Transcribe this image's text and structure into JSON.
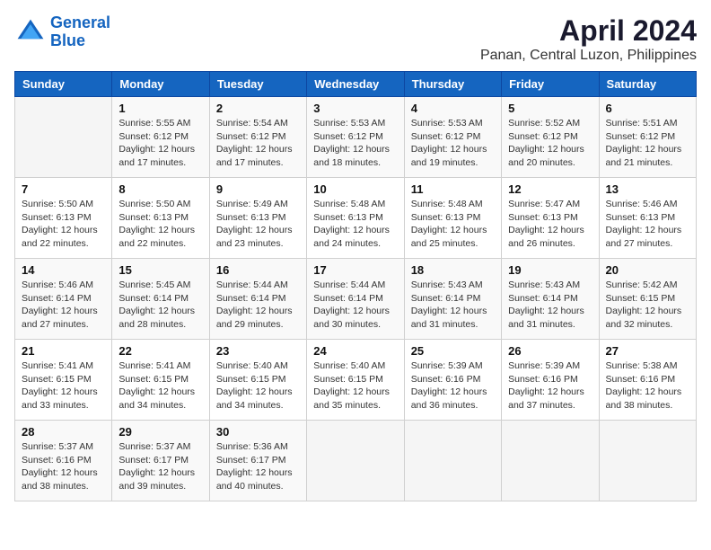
{
  "logo": {
    "line1": "General",
    "line2": "Blue"
  },
  "title": "April 2024",
  "subtitle": "Panan, Central Luzon, Philippines",
  "weekdays": [
    "Sunday",
    "Monday",
    "Tuesday",
    "Wednesday",
    "Thursday",
    "Friday",
    "Saturday"
  ],
  "weeks": [
    [
      {
        "day": "",
        "detail": ""
      },
      {
        "day": "1",
        "detail": "Sunrise: 5:55 AM\nSunset: 6:12 PM\nDaylight: 12 hours\nand 17 minutes."
      },
      {
        "day": "2",
        "detail": "Sunrise: 5:54 AM\nSunset: 6:12 PM\nDaylight: 12 hours\nand 17 minutes."
      },
      {
        "day": "3",
        "detail": "Sunrise: 5:53 AM\nSunset: 6:12 PM\nDaylight: 12 hours\nand 18 minutes."
      },
      {
        "day": "4",
        "detail": "Sunrise: 5:53 AM\nSunset: 6:12 PM\nDaylight: 12 hours\nand 19 minutes."
      },
      {
        "day": "5",
        "detail": "Sunrise: 5:52 AM\nSunset: 6:12 PM\nDaylight: 12 hours\nand 20 minutes."
      },
      {
        "day": "6",
        "detail": "Sunrise: 5:51 AM\nSunset: 6:12 PM\nDaylight: 12 hours\nand 21 minutes."
      }
    ],
    [
      {
        "day": "7",
        "detail": "Sunrise: 5:50 AM\nSunset: 6:13 PM\nDaylight: 12 hours\nand 22 minutes."
      },
      {
        "day": "8",
        "detail": "Sunrise: 5:50 AM\nSunset: 6:13 PM\nDaylight: 12 hours\nand 22 minutes."
      },
      {
        "day": "9",
        "detail": "Sunrise: 5:49 AM\nSunset: 6:13 PM\nDaylight: 12 hours\nand 23 minutes."
      },
      {
        "day": "10",
        "detail": "Sunrise: 5:48 AM\nSunset: 6:13 PM\nDaylight: 12 hours\nand 24 minutes."
      },
      {
        "day": "11",
        "detail": "Sunrise: 5:48 AM\nSunset: 6:13 PM\nDaylight: 12 hours\nand 25 minutes."
      },
      {
        "day": "12",
        "detail": "Sunrise: 5:47 AM\nSunset: 6:13 PM\nDaylight: 12 hours\nand 26 minutes."
      },
      {
        "day": "13",
        "detail": "Sunrise: 5:46 AM\nSunset: 6:13 PM\nDaylight: 12 hours\nand 27 minutes."
      }
    ],
    [
      {
        "day": "14",
        "detail": "Sunrise: 5:46 AM\nSunset: 6:14 PM\nDaylight: 12 hours\nand 27 minutes."
      },
      {
        "day": "15",
        "detail": "Sunrise: 5:45 AM\nSunset: 6:14 PM\nDaylight: 12 hours\nand 28 minutes."
      },
      {
        "day": "16",
        "detail": "Sunrise: 5:44 AM\nSunset: 6:14 PM\nDaylight: 12 hours\nand 29 minutes."
      },
      {
        "day": "17",
        "detail": "Sunrise: 5:44 AM\nSunset: 6:14 PM\nDaylight: 12 hours\nand 30 minutes."
      },
      {
        "day": "18",
        "detail": "Sunrise: 5:43 AM\nSunset: 6:14 PM\nDaylight: 12 hours\nand 31 minutes."
      },
      {
        "day": "19",
        "detail": "Sunrise: 5:43 AM\nSunset: 6:14 PM\nDaylight: 12 hours\nand 31 minutes."
      },
      {
        "day": "20",
        "detail": "Sunrise: 5:42 AM\nSunset: 6:15 PM\nDaylight: 12 hours\nand 32 minutes."
      }
    ],
    [
      {
        "day": "21",
        "detail": "Sunrise: 5:41 AM\nSunset: 6:15 PM\nDaylight: 12 hours\nand 33 minutes."
      },
      {
        "day": "22",
        "detail": "Sunrise: 5:41 AM\nSunset: 6:15 PM\nDaylight: 12 hours\nand 34 minutes."
      },
      {
        "day": "23",
        "detail": "Sunrise: 5:40 AM\nSunset: 6:15 PM\nDaylight: 12 hours\nand 34 minutes."
      },
      {
        "day": "24",
        "detail": "Sunrise: 5:40 AM\nSunset: 6:15 PM\nDaylight: 12 hours\nand 35 minutes."
      },
      {
        "day": "25",
        "detail": "Sunrise: 5:39 AM\nSunset: 6:16 PM\nDaylight: 12 hours\nand 36 minutes."
      },
      {
        "day": "26",
        "detail": "Sunrise: 5:39 AM\nSunset: 6:16 PM\nDaylight: 12 hours\nand 37 minutes."
      },
      {
        "day": "27",
        "detail": "Sunrise: 5:38 AM\nSunset: 6:16 PM\nDaylight: 12 hours\nand 38 minutes."
      }
    ],
    [
      {
        "day": "28",
        "detail": "Sunrise: 5:37 AM\nSunset: 6:16 PM\nDaylight: 12 hours\nand 38 minutes."
      },
      {
        "day": "29",
        "detail": "Sunrise: 5:37 AM\nSunset: 6:17 PM\nDaylight: 12 hours\nand 39 minutes."
      },
      {
        "day": "30",
        "detail": "Sunrise: 5:36 AM\nSunset: 6:17 PM\nDaylight: 12 hours\nand 40 minutes."
      },
      {
        "day": "",
        "detail": ""
      },
      {
        "day": "",
        "detail": ""
      },
      {
        "day": "",
        "detail": ""
      },
      {
        "day": "",
        "detail": ""
      }
    ]
  ]
}
